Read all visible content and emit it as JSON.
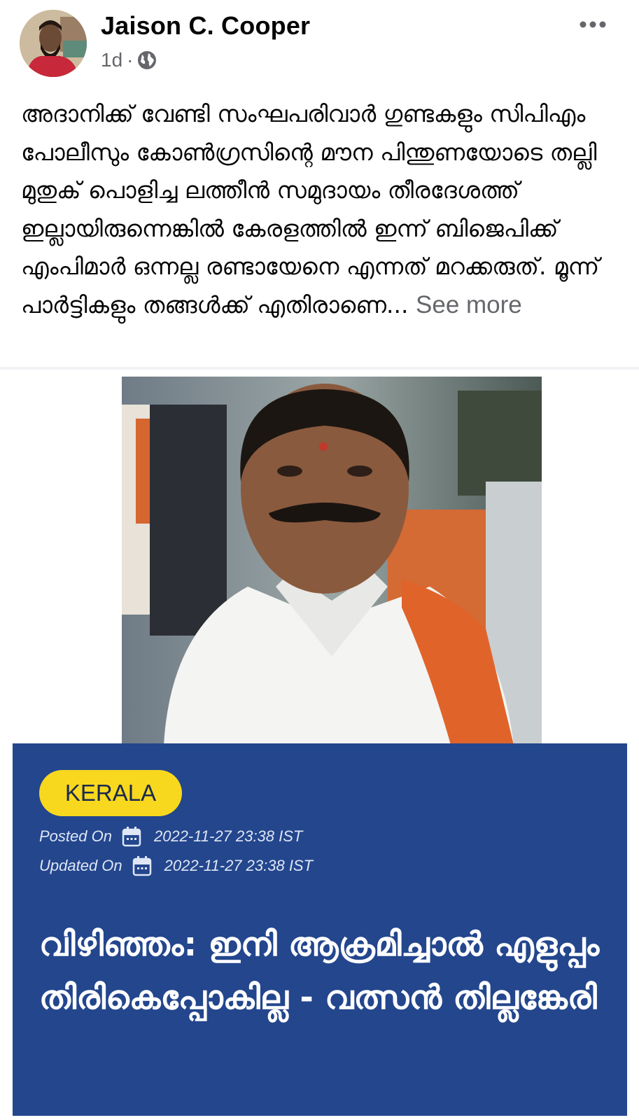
{
  "post": {
    "author": "Jaison C. Cooper",
    "time": "1d",
    "separator": "·",
    "privacy_icon": "globe-icon",
    "menu_icon": "more-horizontal-icon",
    "text": "അദാനിക്ക് വേണ്ടി സംഘപരിവാർ ഗുണ്ടകളും സിപിഎം പോലീസും കോൺഗ്രസിന്റെ മൗന പിന്തുണയോടെ തല്ലി മുതുക് പൊളിച്ച ലത്തീൻ സമുദായം തീരദേശത്ത് ഇല്ലായിരുന്നെങ്കിൽ കേരളത്തിൽ ഇന്ന് ബിജെപിക്ക് എംപിമാർ ഒന്നല്ല രണ്ടായേനെ എന്നത് മറക്കരുത്. മൂന്ന് പാർട്ടികളും തങ്ങൾക്ക് എതിരാണെ...",
    "see_more": "See more"
  },
  "news_card": {
    "category": "KERALA",
    "posted_label": "Posted On",
    "posted_value": "2022-11-27 23:38 IST",
    "updated_label": "Updated On",
    "updated_value": "2022-11-27 23:38 IST",
    "calendar_icon": "calendar-icon",
    "headline": "വിഴിഞ്ഞം: ഇനി ആക്രമിച്ചാൽ എളുപ്പം തിരികെപ്പോകില്ല - വത്സൻ തില്ലങ്കേരി"
  },
  "colors": {
    "panel": "#23468d",
    "badge": "#f8d81e",
    "secondary_text": "#65676b"
  }
}
